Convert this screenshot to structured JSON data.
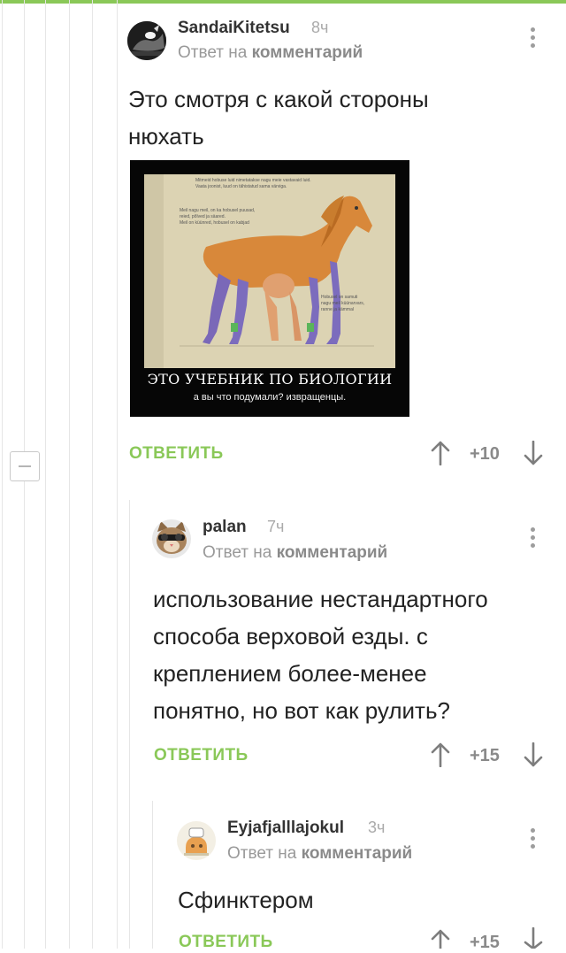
{
  "comments": [
    {
      "username": "SandaiKitetsu",
      "time": "8ч",
      "reply_prefix": "Ответ на",
      "reply_link": "комментарий",
      "text_lines": [
        "Это смотря с какой стороны",
        "нюхать"
      ],
      "image": {
        "caption": "ЭТО УЧЕБНИК ПО БИОЛОГИИ",
        "subcaption": "а вы что подумали? извращенцы.",
        "top_text": [
          "Mitmeid hobuse luid nimetatakse nagu meie vastavaid luid.",
          "Vaata joonist, luud on tähistatud sama värviga."
        ],
        "left_text": [
          "Meil nagu meil, on ka hobusel puusad,",
          "reied, põlved ja säared.",
          "Meil on küünred, hobusel on kabjad"
        ],
        "right_text": [
          "Hobusel on samuti",
          "nagu meil küünarvars,",
          "ranne ja kämmal"
        ]
      },
      "reply_label": "ОТВЕТИТЬ",
      "rating": "+10"
    },
    {
      "username": "palan",
      "time": "7ч",
      "reply_prefix": "Ответ на",
      "reply_link": "комментарий",
      "text_lines": [
        "использование нестандартного",
        "способа верховой езды. с",
        "креплением более-менее",
        "понятно, но вот как рулить?"
      ],
      "reply_label": "ОТВЕТИТЬ",
      "rating": "+15"
    },
    {
      "username": "Eyjafjalllajokul",
      "time": "3ч",
      "reply_prefix": "Ответ на",
      "reply_link": "комментарий",
      "text_lines": [
        "Сфинктером"
      ],
      "reply_label": "ОТВЕТИТЬ",
      "rating": "+15"
    }
  ],
  "colors": {
    "accent": "#8ac858",
    "muted_text": "#999999",
    "thread_line": "#e6e6e6"
  },
  "icons": [
    "kebab-menu-icon",
    "arrow-up-icon",
    "arrow-down-icon",
    "collapse-minus-icon"
  ]
}
